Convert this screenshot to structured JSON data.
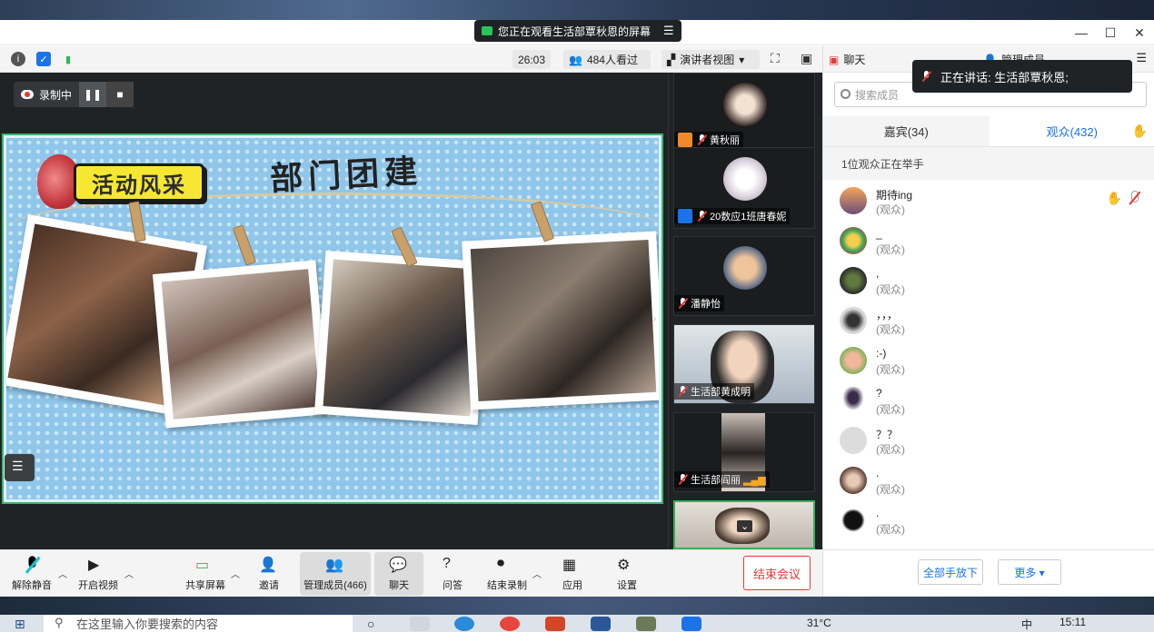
{
  "window": {
    "viewing_notice": "您正在观看生活部覃秋恩的屏幕",
    "menu_icon": "☰",
    "minimize": "—",
    "maximize": "☐",
    "close": "✕"
  },
  "toolbar": {
    "timer": "26:03",
    "viewers": "484人看过",
    "view_mode": "演讲者视图",
    "colors": {
      "info": "#555555",
      "shield": "#1a73e8",
      "signal": "#2fb55a"
    }
  },
  "chat_header": {
    "chat_tab": "聊天",
    "members_tab": "管理成员"
  },
  "speaking_toast": {
    "text": "正在讲话: 生活部覃秋恩;"
  },
  "recording": {
    "label": "录制中",
    "pause_icon": "❚❚",
    "stop_icon": "■"
  },
  "slide": {
    "badge_text": "活动风采",
    "headline": "部门团建"
  },
  "thumbnails": [
    {
      "name": "黄秋丽"
    },
    {
      "name": "20数应1班唐春妮"
    },
    {
      "name": "潘静怡"
    },
    {
      "name": "生活部黄成明"
    },
    {
      "name": "生活部阎丽"
    },
    {
      "name": ""
    }
  ],
  "members_panel": {
    "search_placeholder": "搜索成员",
    "tab_guests": "嘉宾(34)",
    "tab_audience": "观众(432)",
    "raise_note": "1位观众正在举手",
    "members": [
      {
        "name": "期待ing",
        "role": "(观众)"
      },
      {
        "name": "_",
        "role": "(观众)"
      },
      {
        "name": ",",
        "role": "(观众)"
      },
      {
        "name": "，，，",
        "role": "(观众)"
      },
      {
        "name": ":-)",
        "role": "(观众)"
      },
      {
        "name": "?",
        "role": "(观众)"
      },
      {
        "name": "？？",
        "role": "(观众)"
      },
      {
        "name": ".",
        "role": "(观众)"
      },
      {
        "name": ".",
        "role": "(观众)"
      }
    ],
    "lower_all_hands": "全部手放下",
    "more": "更多 ▾"
  },
  "bottom_bar": {
    "unmute": "解除静音",
    "start_video": "开启视频",
    "share_screen": "共享屏幕",
    "invite": "邀请",
    "manage_members": "管理成员(466)",
    "chat": "聊天",
    "qa": "问答",
    "end_recording": "结束录制",
    "apps": "应用",
    "settings": "设置",
    "end_meeting": "结束会议"
  },
  "taskbar": {
    "search_placeholder": "在这里输入你要搜索的内容",
    "temperature": "31°C",
    "ime": "中",
    "time": "15:11"
  }
}
